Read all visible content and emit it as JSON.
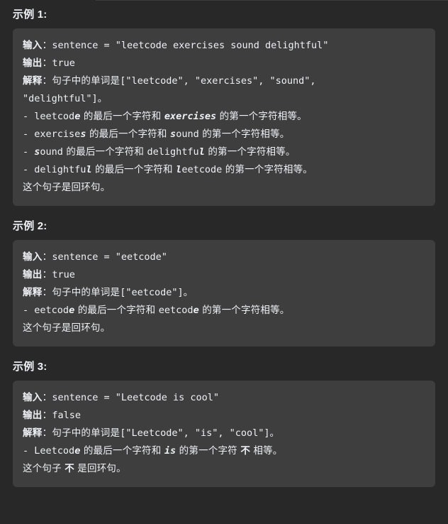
{
  "theme": {
    "page_background": "#282828",
    "panel_background": "#3e3e3e",
    "text_color": "#eff1f6",
    "rule_color": "#3d3d3d"
  },
  "labels": {
    "input": "输入",
    "output": "输出",
    "explanation": "解释",
    "colon": "：",
    "bullet": "-",
    "words_are": "句子中的单词是",
    "last_char_and": " 的最后一个字符和 ",
    "first_char_equal": " 的第一个字符相等。",
    "first_char": " 的第一个字符 ",
    "not": "不",
    "equal_suffix": " 相等。",
    "is_circular": "这个句子是回环句。",
    "is_not_circular_a": "这个句子 ",
    "is_not_circular_b": " 是回环句。"
  },
  "examples": [
    {
      "heading": "示例 1:",
      "input_expr": "sentence = \"leetcode exercises sound delightful\"",
      "output_value": "true",
      "words_array": "[\"leetcode\", \"exercises\", \"sound\", \"delightful\"]",
      "array_period": "。",
      "comparisons": [
        {
          "left_plain": "leetcod",
          "left_em": "e",
          "right_em": "exercises",
          "right_plain": ""
        },
        {
          "left_plain": "exercise",
          "left_em": "s",
          "right_em": "s",
          "right_plain": "ound"
        },
        {
          "left_plain": "",
          "left_em": "s",
          "left_tail": "ound",
          "right_em": "d",
          "right_plain": "elightful"
        },
        {
          "left_plain": "delightfu",
          "left_em": "l",
          "right_em": "l",
          "right_plain": "eetcode"
        }
      ],
      "conclusion": "这个句子是回环句。"
    },
    {
      "heading": "示例 2:",
      "input_expr": "sentence = \"eetcode\"",
      "output_value": "true",
      "words_array": "[\"eetcode\"]",
      "array_period": "。",
      "comparisons": [
        {
          "left_plain": "eetcod",
          "left_em": "e",
          "right_em": "e",
          "right_plain": "etcode"
        }
      ],
      "conclusion": "这个句子是回环句。"
    },
    {
      "heading": "示例 3:",
      "input_expr": "sentence = \"Leetcode is cool\"",
      "output_value": "false",
      "words_array": "[\"Leetcode\", \"is\", \"cool\"]",
      "array_period": "。",
      "comparisons": [
        {
          "left_plain": "Leetcod",
          "left_em": "e",
          "right_em": "is",
          "right_plain": ""
        }
      ],
      "conclusion_not": "这个句子 不 是回环句。"
    }
  ],
  "example1": {
    "heading": "示例 1:",
    "input_label": "输入",
    "input_expr": "sentence = \"leetcode exercises sound delightful\"",
    "output_label": "输出",
    "output_value": "true",
    "explanation_label": "解释",
    "explanation_prefix": "句子中的单词是",
    "words_array": "[\"leetcode\", \"exercises\", \"sound\",",
    "words_array_cont": "\"delightful\"]",
    "array_period": "。",
    "b1_pre": "leetcod",
    "b1_em": "e",
    "b1_mid": " 的最后一个字符和 ",
    "b1_em2": "exercises",
    "b1_post": " 的第一个字符相等。",
    "b2_pre": "exercise",
    "b2_em": "s",
    "b2_mid": " 的最后一个字符和 ",
    "b2_em2": "s",
    "b2_tail2": "ound",
    "b2_post": " 的第一个字符相等。",
    "b3_em": "s",
    "b3_tail": "ound",
    "b3_mid": " 的最后一个字符和 ",
    "b3_pre2": "delightfu",
    "b3_em2": "l",
    "b3_post": " 的第一个字符相等。",
    "b4_pre": "delightfu",
    "b4_em": "l",
    "b4_mid": " 的最后一个字符和 ",
    "b4_em2": "l",
    "b4_tail2": "eetcode",
    "b4_post": " 的第一个字符相等。",
    "conclusion": "这个句子是回环句。"
  },
  "example2": {
    "heading": "示例 2:",
    "input_label": "输入",
    "input_expr": "sentence = \"eetcode\"",
    "output_label": "输出",
    "output_value": "true",
    "explanation_label": "解释",
    "explanation_prefix": "句子中的单词是",
    "words_array": "[\"eetcode\"]",
    "array_period": "。",
    "b1_pre": "eetcod",
    "b1_em": "e",
    "b1_mid": " 的最后一个字符和 ",
    "b1_pre2": "eetcod",
    "b1_em2": "e",
    "b1_post": " 的第一个字符相等。",
    "conclusion": "这个句子是回环句。"
  },
  "example3": {
    "heading": "示例 3:",
    "input_label": "输入",
    "input_expr": "sentence = \"Leetcode is cool\"",
    "output_label": "输出",
    "output_value": "false",
    "explanation_label": "解释",
    "explanation_prefix": "句子中的单词是",
    "words_array": "[\"Leetcode\", \"is\", \"cool\"]",
    "array_period": "。",
    "b1_pre": "Leetcod",
    "b1_em": "e",
    "b1_mid": " 的最后一个字符和 ",
    "b1_em2": "is",
    "b1_mid2": " 的第一个字符 ",
    "b1_not": "不",
    "b1_post": " 相等。",
    "conclusion_a": "这个句子 ",
    "conclusion_not": "不",
    "conclusion_b": " 是回环句。"
  }
}
